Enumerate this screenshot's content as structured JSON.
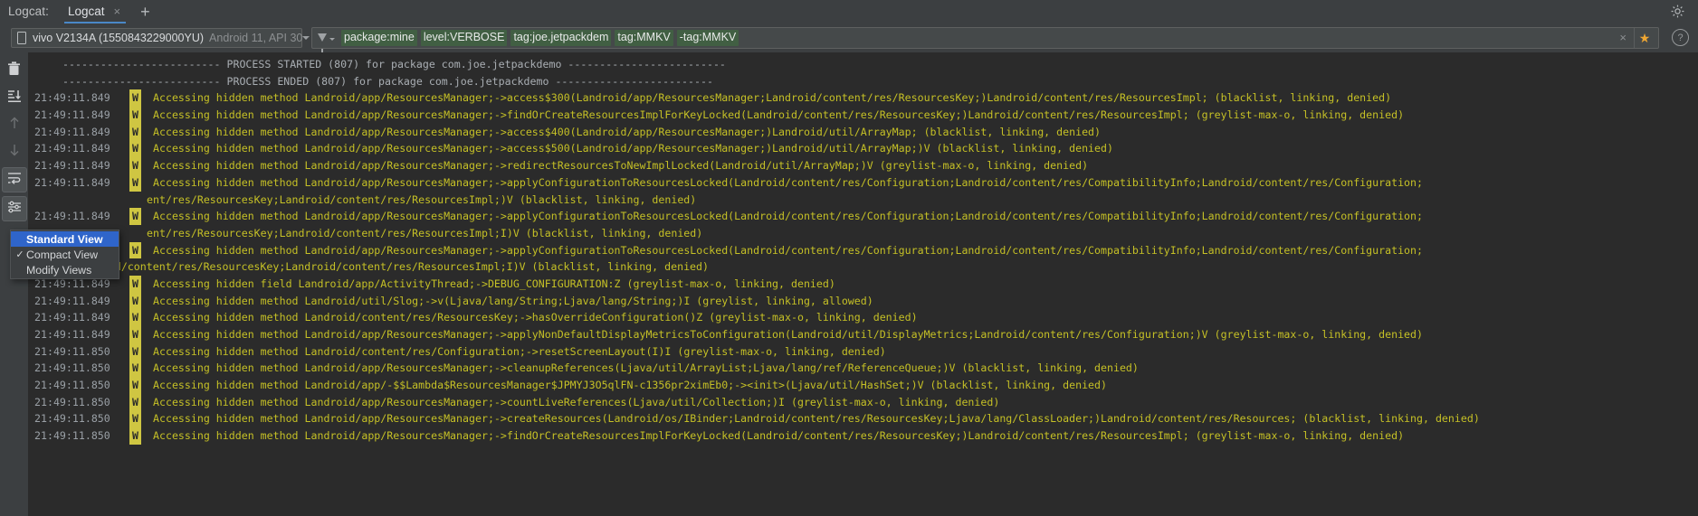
{
  "window": {
    "tool_label": "Logcat:",
    "settings_icon": "gear-icon"
  },
  "tabs": [
    {
      "label": "Logcat",
      "close_glyph": "×",
      "active": true
    }
  ],
  "tab_add_glyph": "+",
  "device_selector": {
    "icon": "phone-icon",
    "name": "vivo V2134A (1550843229000YU)",
    "api": "Android 11, API 30"
  },
  "filter_bar": {
    "funnel_icon": "filter-icon",
    "chips": [
      "package:mine",
      "level:VERBOSE",
      "tag:joe.jetpackdem",
      "tag:MMKV",
      "-tag:MMKV"
    ],
    "clear_glyph": "×",
    "star_glyph": "★",
    "help_glyph": "?"
  },
  "left_toolbar": [
    {
      "name": "clear-logcat-button",
      "icon": "trash-icon",
      "enabled": true,
      "selected": false
    },
    {
      "name": "scroll-to-end-button",
      "icon": "scroll-to-end-icon",
      "enabled": true,
      "selected": false
    },
    {
      "name": "previous-occurrence-button",
      "icon": "arrow-up-icon",
      "enabled": false,
      "selected": false
    },
    {
      "name": "next-occurrence-button",
      "icon": "arrow-down-icon",
      "enabled": false,
      "selected": false
    },
    {
      "name": "soft-wraps-button",
      "icon": "soft-wrap-icon",
      "enabled": true,
      "selected": true
    },
    {
      "name": "configure-view-button",
      "icon": "sliders-icon",
      "enabled": true,
      "selected": true
    }
  ],
  "context_menu": {
    "items": [
      {
        "label": "Standard View",
        "checked": false,
        "highlighted": true
      },
      {
        "label": "Compact View",
        "checked": true,
        "highlighted": false
      },
      {
        "label": "Modify Views",
        "checked": false,
        "highlighted": false
      }
    ],
    "check_glyph": "✓"
  },
  "log": {
    "lines": [
      {
        "type": "system",
        "text": "------------------------- PROCESS STARTED (807) for package com.joe.jetpackdemo -------------------------"
      },
      {
        "type": "system",
        "text": "------------------------- PROCESS ENDED (807) for package com.joe.jetpackdemo -------------------------"
      },
      {
        "type": "entry",
        "ts": "21:49:11.849",
        "level": "W",
        "msg": "Accessing hidden method Landroid/app/ResourcesManager;->access$300(Landroid/app/ResourcesManager;Landroid/content/res/ResourcesKey;)Landroid/content/res/ResourcesImpl; (blacklist, linking, denied)"
      },
      {
        "type": "entry",
        "ts": "21:49:11.849",
        "level": "W",
        "msg": "Accessing hidden method Landroid/app/ResourcesManager;->findOrCreateResourcesImplForKeyLocked(Landroid/content/res/ResourcesKey;)Landroid/content/res/ResourcesImpl; (greylist-max-o, linking, denied)"
      },
      {
        "type": "entry",
        "ts": "21:49:11.849",
        "level": "W",
        "msg": "Accessing hidden method Landroid/app/ResourcesManager;->access$400(Landroid/app/ResourcesManager;)Landroid/util/ArrayMap; (blacklist, linking, denied)"
      },
      {
        "type": "entry",
        "ts": "21:49:11.849",
        "level": "W",
        "msg": "Accessing hidden method Landroid/app/ResourcesManager;->access$500(Landroid/app/ResourcesManager;)Landroid/util/ArrayMap;)V (blacklist, linking, denied)"
      },
      {
        "type": "entry",
        "ts": "21:49:11.849",
        "level": "W",
        "msg": "Accessing hidden method Landroid/app/ResourcesManager;->redirectResourcesToNewImplLocked(Landroid/util/ArrayMap;)V (greylist-max-o, linking, denied)"
      },
      {
        "type": "entry",
        "ts": "21:49:11.849",
        "level": "W",
        "msg": "Accessing hidden method Landroid/app/ResourcesManager;->applyConfigurationToResourcesLocked(Landroid/content/res/Configuration;Landroid/content/res/CompatibilityInfo;Landroid/content/res/Configuration;"
      },
      {
        "type": "cont",
        "text": "ent/res/ResourcesKey;Landroid/content/res/ResourcesImpl;)V (blacklist, linking, denied)"
      },
      {
        "type": "entry",
        "ts": "21:49:11.849",
        "level": "W",
        "msg": "Accessing hidden method Landroid/app/ResourcesManager;->applyConfigurationToResourcesLocked(Landroid/content/res/Configuration;Landroid/content/res/CompatibilityInfo;Landroid/content/res/Configuration;"
      },
      {
        "type": "cont",
        "text": "ent/res/ResourcesKey;Landroid/content/res/ResourcesImpl;I)V (blacklist, linking, denied)"
      },
      {
        "type": "entry",
        "ts": "21:49:11.849",
        "level": "W",
        "msg": "Accessing hidden method Landroid/app/ResourcesManager;->applyConfigurationToResourcesLocked(Landroid/content/res/Configuration;Landroid/content/res/CompatibilityInfo;Landroid/content/res/Configuration;"
      },
      {
        "type": "cont",
        "text": "Landroid/content/res/ResourcesKey;Landroid/content/res/ResourcesImpl;I)V (blacklist, linking, denied)",
        "indent": "left"
      },
      {
        "type": "entry",
        "ts": "21:49:11.849",
        "level": "W",
        "msg": "Accessing hidden field Landroid/app/ActivityThread;->DEBUG_CONFIGURATION:Z (greylist-max-o, linking, denied)"
      },
      {
        "type": "entry",
        "ts": "21:49:11.849",
        "level": "W",
        "msg": "Accessing hidden method Landroid/util/Slog;->v(Ljava/lang/String;Ljava/lang/String;)I (greylist, linking, allowed)"
      },
      {
        "type": "entry",
        "ts": "21:49:11.849",
        "level": "W",
        "msg": "Accessing hidden method Landroid/content/res/ResourcesKey;->hasOverrideConfiguration()Z (greylist-max-o, linking, denied)"
      },
      {
        "type": "entry",
        "ts": "21:49:11.849",
        "level": "W",
        "msg": "Accessing hidden method Landroid/app/ResourcesManager;->applyNonDefaultDisplayMetricsToConfiguration(Landroid/util/DisplayMetrics;Landroid/content/res/Configuration;)V (greylist-max-o, linking, denied)"
      },
      {
        "type": "entry",
        "ts": "21:49:11.850",
        "level": "W",
        "msg": "Accessing hidden method Landroid/content/res/Configuration;->resetScreenLayout(I)I (greylist-max-o, linking, denied)"
      },
      {
        "type": "entry",
        "ts": "21:49:11.850",
        "level": "W",
        "msg": "Accessing hidden method Landroid/app/ResourcesManager;->cleanupReferences(Ljava/util/ArrayList;Ljava/lang/ref/ReferenceQueue;)V (blacklist, linking, denied)"
      },
      {
        "type": "entry",
        "ts": "21:49:11.850",
        "level": "W",
        "msg": "Accessing hidden method Landroid/app/-$$Lambda$ResourcesManager$JPMYJ3O5qlFN-c1356pr2ximEb0;-><init>(Ljava/util/HashSet;)V (blacklist, linking, denied)"
      },
      {
        "type": "entry",
        "ts": "21:49:11.850",
        "level": "W",
        "msg": "Accessing hidden method Landroid/app/ResourcesManager;->countLiveReferences(Ljava/util/Collection;)I (greylist-max-o, linking, denied)"
      },
      {
        "type": "entry",
        "ts": "21:49:11.850",
        "level": "W",
        "msg": "Accessing hidden method Landroid/app/ResourcesManager;->createResources(Landroid/os/IBinder;Landroid/content/res/ResourcesKey;Ljava/lang/ClassLoader;)Landroid/content/res/Resources; (blacklist, linking, denied)"
      },
      {
        "type": "entry",
        "ts": "21:49:11.850",
        "level": "W",
        "msg": "Accessing hidden method Landroid/app/ResourcesManager;->findOrCreateResourcesImplForKeyLocked(Landroid/content/res/ResourcesKey;)Landroid/content/res/ResourcesImpl; (greylist-max-o, linking, denied)"
      }
    ]
  },
  "colors": {
    "panel_bg": "#3c3f41",
    "log_bg": "#2b2b2b",
    "warn_text": "#c5c026",
    "warn_badge": "#cfc642",
    "chip_bg": "#415f43",
    "menu_highlight": "#2f65ca",
    "star": "#f0a732",
    "tab_underline": "#4a88c7"
  }
}
